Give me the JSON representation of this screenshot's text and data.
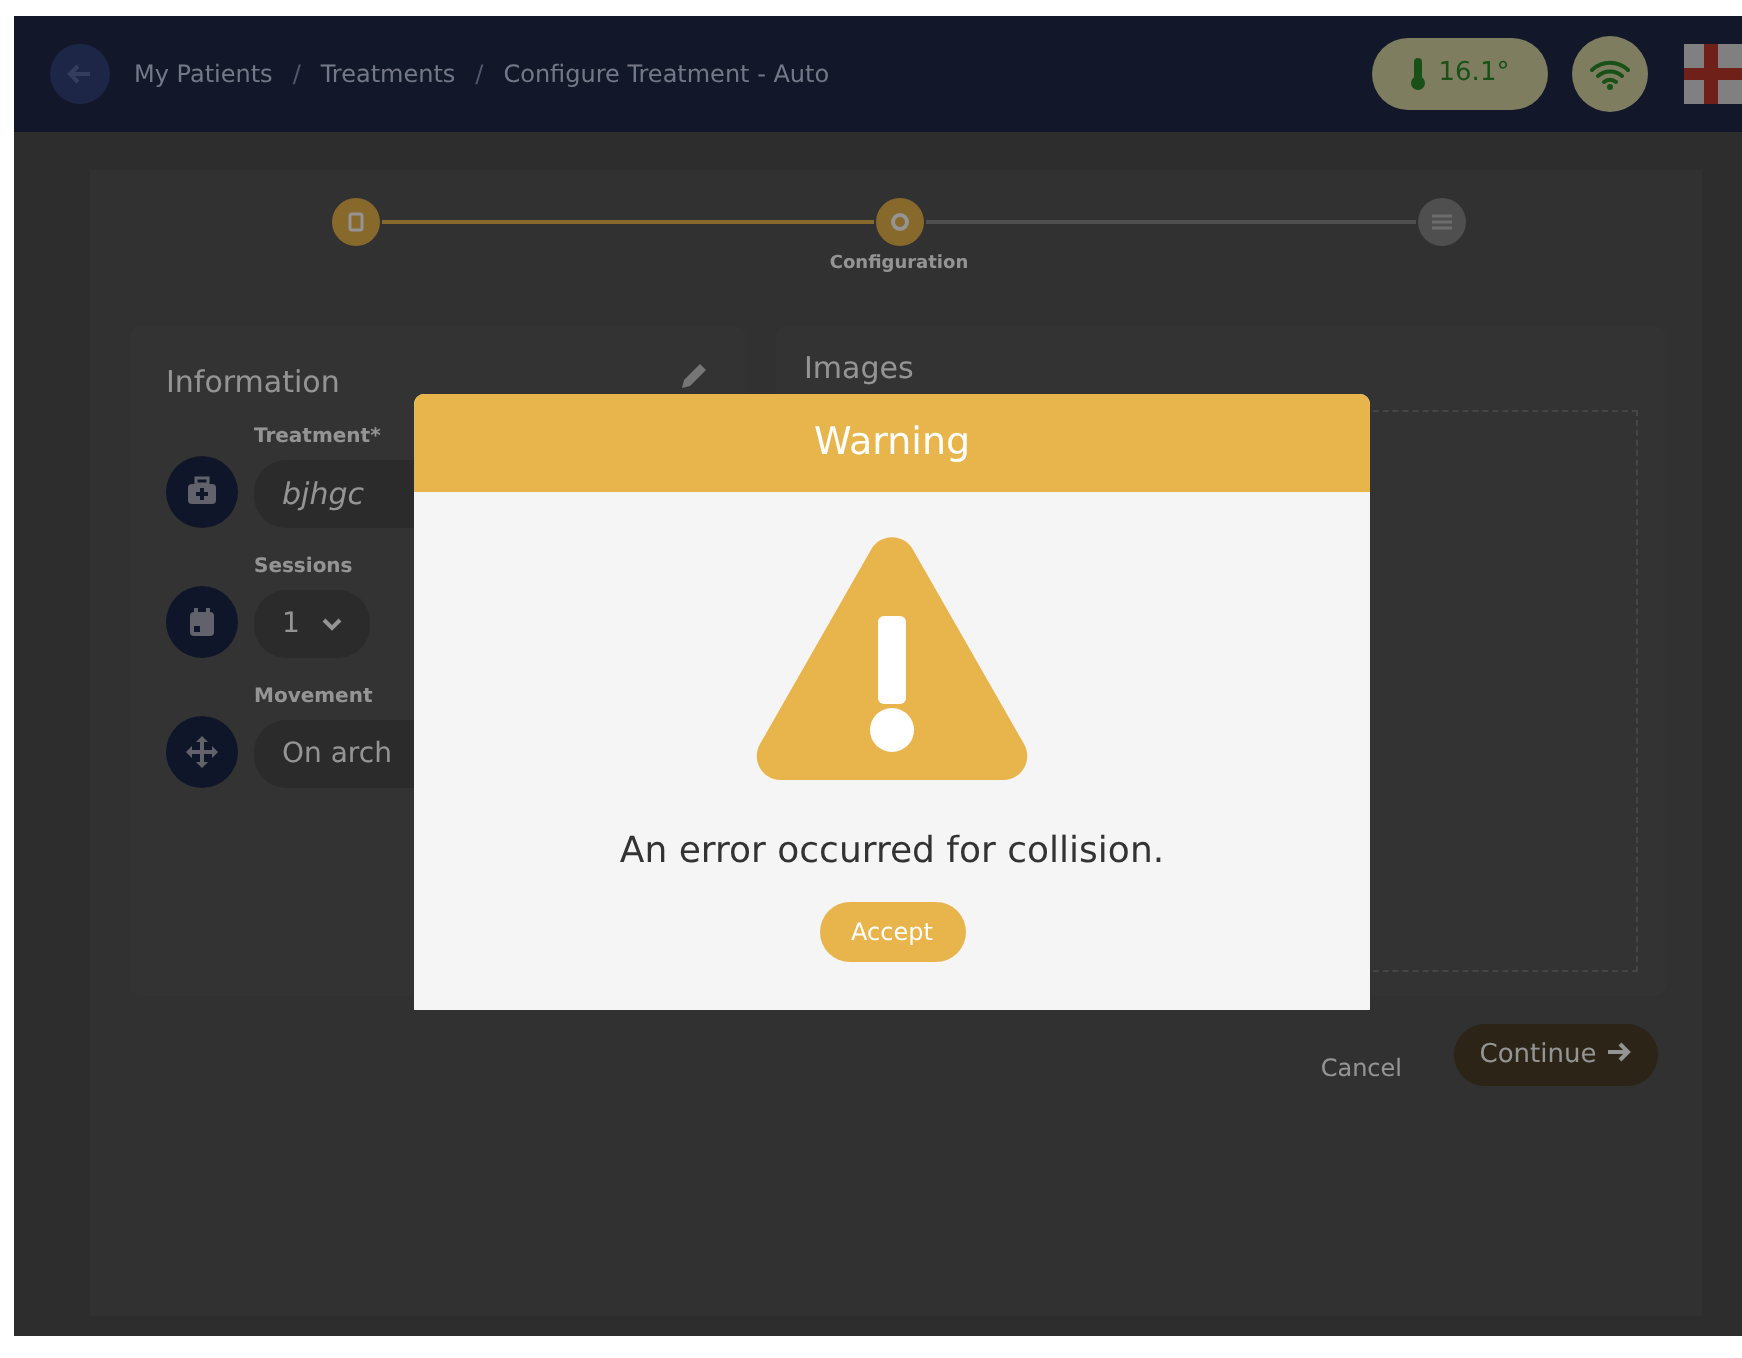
{
  "navbar": {
    "breadcrumbs": [
      {
        "kind": "link",
        "text": "My Patients"
      },
      {
        "kind": "separator",
        "text": "/"
      },
      {
        "kind": "link",
        "text": "Treatments"
      },
      {
        "kind": "separator",
        "text": "/"
      },
      {
        "kind": "link",
        "text": "Configure Treatment - Auto"
      }
    ],
    "temperature": "16.1°"
  },
  "stepper": {
    "steps": [
      {
        "completed": true,
        "selected": false
      },
      {
        "completed": false,
        "selected": true,
        "label": "Configuration"
      },
      {
        "completed": false,
        "selected": false
      }
    ]
  },
  "information": {
    "title": "Information",
    "fields": [
      {
        "kind": "text",
        "label": "Treatment*",
        "value": "bjhgc"
      },
      {
        "kind": "select",
        "label": "Sessions",
        "value": "1"
      },
      {
        "kind": "text",
        "label": "Movement",
        "value": "On arch"
      }
    ]
  },
  "images": {
    "title": "Images"
  },
  "actions": {
    "cancel": "Cancel",
    "continue": "Continue"
  },
  "dialog": {
    "title": "Warning",
    "message": "An error occurred for collision.",
    "button": "Accept"
  }
}
